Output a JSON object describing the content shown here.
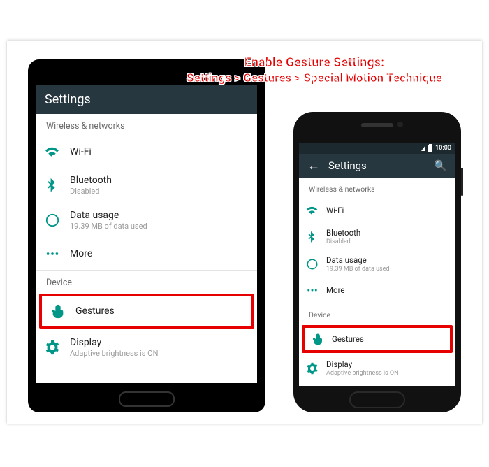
{
  "annotation": {
    "line1": "Enable Gesture Settings:",
    "line2": "Settings > Gestures > Special Motion Technique"
  },
  "status": {
    "time": "10:00"
  },
  "appbar": {
    "title": "Settings",
    "search_label": "Search"
  },
  "sections": {
    "wireless": "Wireless & networks",
    "device": "Device"
  },
  "rows": {
    "wifi": {
      "title": "Wi-Fi",
      "sub": ""
    },
    "bluetooth": {
      "title": "Bluetooth",
      "sub": "Disabled"
    },
    "datausage": {
      "title": "Data usage",
      "sub": "19.39 MB of data used"
    },
    "more": {
      "title": "More",
      "sub": ""
    },
    "gestures": {
      "title": "Gestures",
      "sub": ""
    },
    "display": {
      "title": "Display",
      "sub": "Adaptive brightness is ON"
    }
  }
}
